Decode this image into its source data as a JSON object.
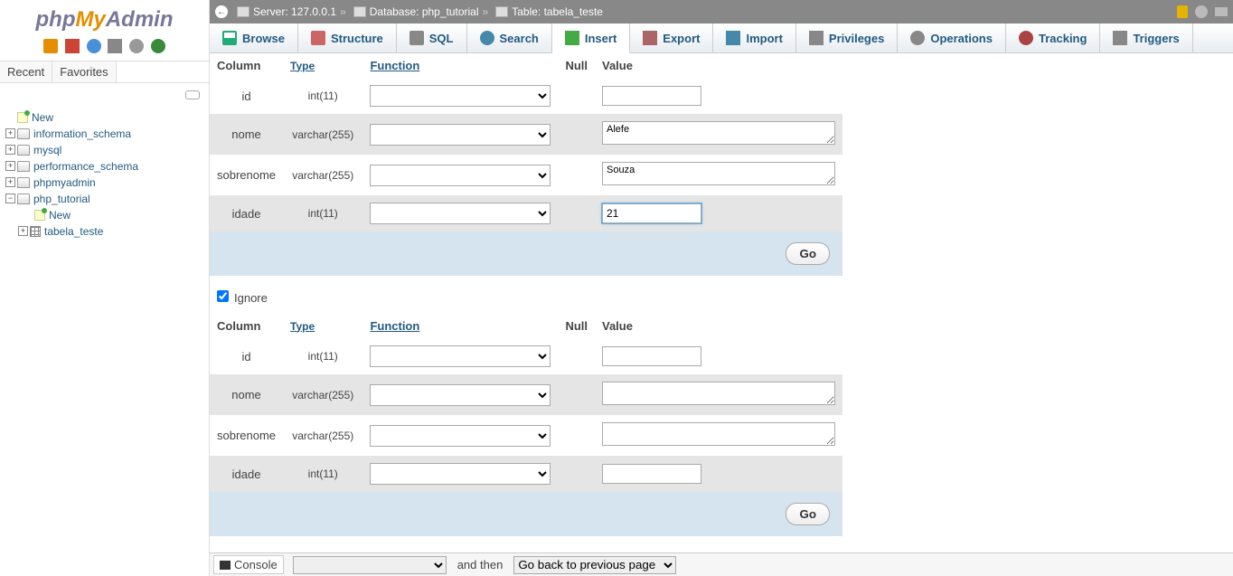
{
  "logo": {
    "php": "php",
    "my": "My",
    "admin": "Admin"
  },
  "sidebar": {
    "recent": "Recent",
    "favorites": "Favorites",
    "items": [
      {
        "label": "New",
        "type": "new"
      },
      {
        "label": "information_schema",
        "type": "db"
      },
      {
        "label": "mysql",
        "type": "db"
      },
      {
        "label": "performance_schema",
        "type": "db"
      },
      {
        "label": "phpmyadmin",
        "type": "db"
      },
      {
        "label": "php_tutorial",
        "type": "db"
      }
    ],
    "child_new": "New",
    "child_table": "tabela_teste"
  },
  "breadcrumb": {
    "server_label": "Server:",
    "server": "127.0.0.1",
    "database_label": "Database:",
    "database": "php_tutorial",
    "table_label": "Table:",
    "table": "tabela_teste"
  },
  "tabs": {
    "browse": "Browse",
    "structure": "Structure",
    "sql": "SQL",
    "search": "Search",
    "insert": "Insert",
    "export": "Export",
    "import": "Import",
    "privileges": "Privileges",
    "operations": "Operations",
    "tracking": "Tracking",
    "triggers": "Triggers"
  },
  "headers": {
    "column": "Column",
    "type": "Type",
    "function": "Function",
    "null": "Null",
    "value": "Value"
  },
  "rows1": [
    {
      "name": "id",
      "type": "int(11)",
      "mode": "text",
      "value": ""
    },
    {
      "name": "nome",
      "type": "varchar(255)",
      "mode": "textarea",
      "value": "Alefe"
    },
    {
      "name": "sobrenome",
      "type": "varchar(255)",
      "mode": "textarea",
      "value": "Souza"
    },
    {
      "name": "idade",
      "type": "int(11)",
      "mode": "text",
      "value": "21"
    }
  ],
  "rows2": [
    {
      "name": "id",
      "type": "int(11)",
      "mode": "text",
      "value": ""
    },
    {
      "name": "nome",
      "type": "varchar(255)",
      "mode": "textarea",
      "value": ""
    },
    {
      "name": "sobrenome",
      "type": "varchar(255)",
      "mode": "textarea",
      "value": ""
    },
    {
      "name": "idade",
      "type": "int(11)",
      "mode": "text",
      "value": ""
    }
  ],
  "go": "Go",
  "ignore": "Ignore",
  "console": "Console",
  "bottom": {
    "and_then": "and then",
    "go_back": "Go back to previous page"
  }
}
